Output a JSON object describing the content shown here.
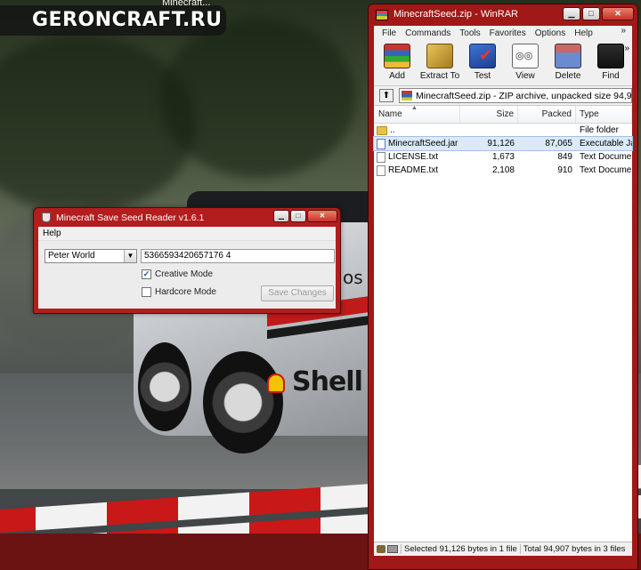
{
  "watermark": {
    "text": "GERONCRAFT.RU"
  },
  "background_window": {
    "title": "Minecraft..."
  },
  "game_scene": {
    "sponsor": "Shell",
    "hood_letters": "os"
  },
  "winrar": {
    "title": "MinecraftSeed.zip - WinRAR",
    "menu": [
      "File",
      "Commands",
      "Tools",
      "Favorites",
      "Options",
      "Help"
    ],
    "menu_more": "»",
    "toolbar": [
      {
        "label": "Add",
        "icon": "add-archive-icon"
      },
      {
        "label": "Extract To",
        "icon": "extract-icon"
      },
      {
        "label": "Test",
        "icon": "test-icon"
      },
      {
        "label": "View",
        "icon": "view-icon"
      },
      {
        "label": "Delete",
        "icon": "delete-icon"
      },
      {
        "label": "Find",
        "icon": "find-icon"
      }
    ],
    "toolbar_more": "»",
    "path": "MinecraftSeed.zip - ZIP archive, unpacked size 94,9",
    "columns": {
      "name": "Name",
      "size": "Size",
      "packed": "Packed",
      "type": "Type"
    },
    "rows": [
      {
        "name": "..",
        "size": "",
        "packed": "",
        "type": "File folder",
        "icon": "folder-icon"
      },
      {
        "name": "MinecraftSeed.jar",
        "size": "91,126",
        "packed": "87,065",
        "type": "Executable Ja",
        "icon": "jar-file-icon"
      },
      {
        "name": "LICENSE.txt",
        "size": "1,673",
        "packed": "849",
        "type": "Text Docume",
        "icon": "text-file-icon"
      },
      {
        "name": "README.txt",
        "size": "2,108",
        "packed": "910",
        "type": "Text Docume",
        "icon": "text-file-icon"
      }
    ],
    "status": {
      "selected": "Selected 91,126 bytes in 1 file",
      "total": "Total 94,907 bytes in 3 files"
    }
  },
  "seed_reader": {
    "title": "Minecraft Save Seed Reader v1.6.1",
    "menu": "Help",
    "world": "Peter World",
    "seed": "5366593420657176 4",
    "creative_label": "Creative Mode",
    "creative_checked": true,
    "hardcore_label": "Hardcore Mode",
    "hardcore_checked": false,
    "save_label": "Save Changes"
  },
  "colors": {
    "window_frame": "#a01818",
    "selection": "#dde9f8"
  }
}
